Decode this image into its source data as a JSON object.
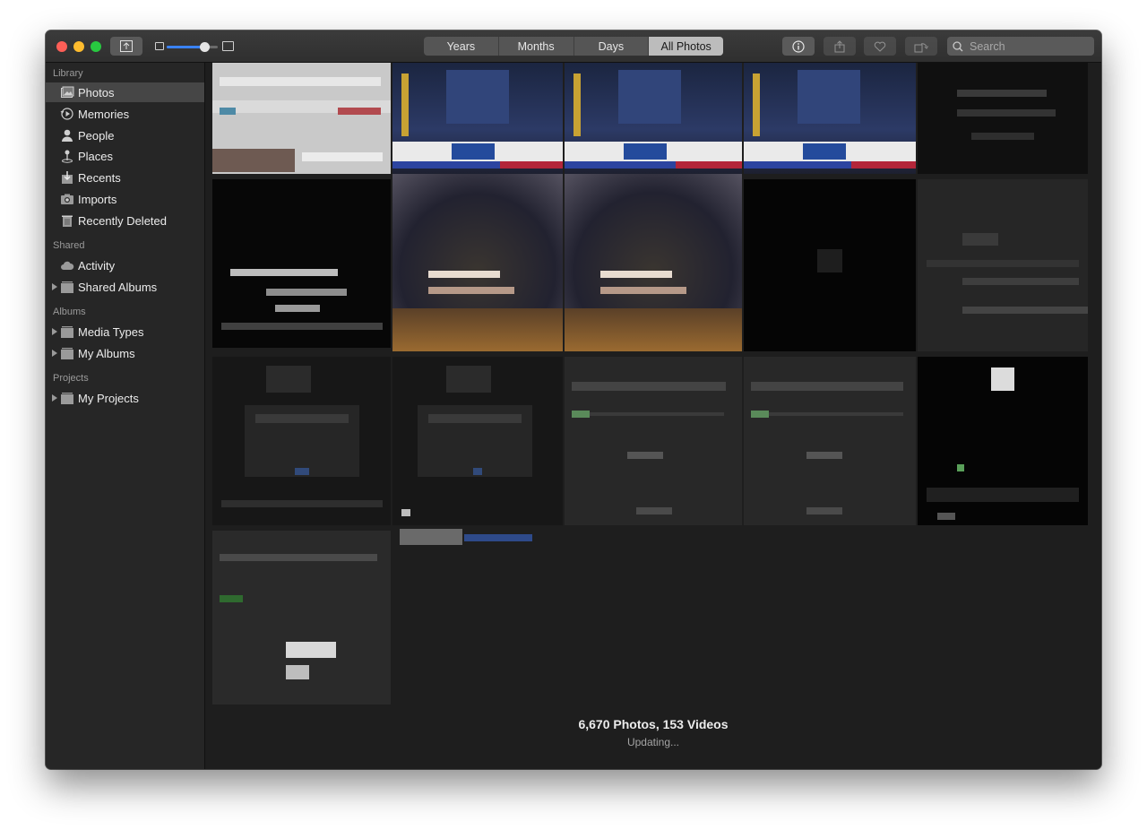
{
  "toolbar": {
    "tabs": [
      {
        "label": "Years",
        "active": false
      },
      {
        "label": "Months",
        "active": false
      },
      {
        "label": "Days",
        "active": false
      },
      {
        "label": "All Photos",
        "active": true
      }
    ],
    "search_placeholder": "Search",
    "zoom_level": 0.8
  },
  "sidebar": {
    "library_title": "Library",
    "library_items": [
      {
        "label": "Photos",
        "icon": "photos-icon",
        "selected": true
      },
      {
        "label": "Memories",
        "icon": "memories-icon"
      },
      {
        "label": "People",
        "icon": "person-icon"
      },
      {
        "label": "Places",
        "icon": "pin-icon"
      },
      {
        "label": "Recents",
        "icon": "tray-icon"
      },
      {
        "label": "Imports",
        "icon": "camera-icon"
      },
      {
        "label": "Recently Deleted",
        "icon": "trash-icon"
      }
    ],
    "shared_title": "Shared",
    "shared_items": [
      {
        "label": "Activity",
        "icon": "cloud-icon"
      },
      {
        "label": "Shared Albums",
        "icon": "folder-icon"
      }
    ],
    "albums_title": "Albums",
    "albums_items": [
      {
        "label": "Media Types",
        "icon": "folder-icon"
      },
      {
        "label": "My Albums",
        "icon": "folder-icon"
      }
    ],
    "projects_title": "Projects",
    "projects_items": [
      {
        "label": "My Projects",
        "icon": "folder-icon"
      }
    ]
  },
  "library_status": {
    "count": "6,670 Photos, 153 Videos",
    "state": "Updating..."
  },
  "colors": {
    "accent": "#3a82f7",
    "close": "#fe5f57",
    "minimize": "#febc2e",
    "maximize": "#28c840"
  }
}
